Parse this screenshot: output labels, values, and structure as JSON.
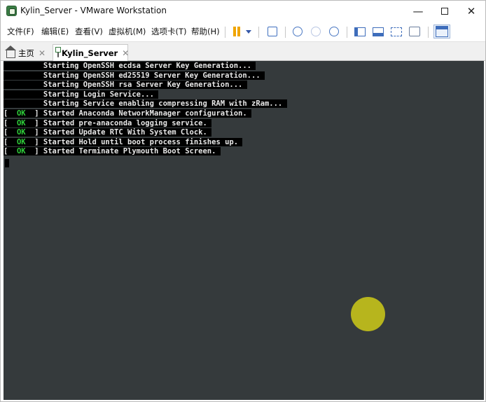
{
  "window": {
    "title": "Kylin_Server - VMware Workstation",
    "controls": {
      "minimize": "—",
      "close": "✕"
    }
  },
  "menu": [
    "文件(F)",
    "编辑(E)",
    "查看(V)",
    "虚拟机(M)",
    "选项卡(T)",
    "帮助(H)"
  ],
  "tabs": [
    {
      "label": "主页",
      "close": "✕"
    },
    {
      "label": "Kylin_Server",
      "close": "✕"
    }
  ],
  "console": {
    "lines": [
      {
        "status": "",
        "text": "         Starting OpenSSH ecdsa Server Key Generation..."
      },
      {
        "status": "",
        "text": "         Starting OpenSSH ed25519 Server Key Generation..."
      },
      {
        "status": "",
        "text": "         Starting OpenSSH rsa Server Key Generation..."
      },
      {
        "status": "",
        "text": "         Starting Login Service..."
      },
      {
        "status": "",
        "text": "         Starting Service enabling compressing RAM with zRam..."
      },
      {
        "status": "OK",
        "text": "Started Anaconda NetworkManager configuration."
      },
      {
        "status": "OK",
        "text": "Started pre-anaconda logging service."
      },
      {
        "status": "OK",
        "text": "Started Update RTC With System Clock."
      },
      {
        "status": "OK",
        "text": "Started Hold until boot process finishes up."
      },
      {
        "status": "OK",
        "text": "Started Terminate Plymouth Boot Screen."
      }
    ]
  },
  "colors": {
    "console_bg": "#353a3c",
    "ok_green": "#2fce3a",
    "spinner": "#b7b51d",
    "pause_orange": "#f0a500"
  },
  "icons": {
    "pause": "pause-icon",
    "dropdown": "chevron-down-icon",
    "network": "network-icon",
    "snapshot": "snapshot-icon",
    "revert": "revert-snapshot-icon",
    "manage": "snapshot-manager-icon",
    "library": "library-panel-icon",
    "console_view": "console-view-icon",
    "fullscreen": "fullscreen-icon",
    "unity": "unity-icon",
    "view": "view-switch-icon"
  }
}
